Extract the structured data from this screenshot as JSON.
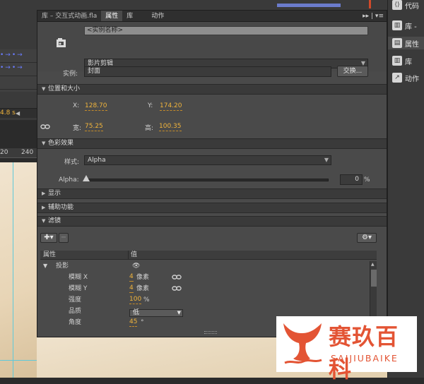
{
  "timeline": {
    "time": "4.8 s"
  },
  "ruler": {
    "ticks": [
      "20",
      "240"
    ]
  },
  "right_panel": {
    "items": [
      {
        "label": "代码"
      },
      {
        "label": "库 -"
      },
      {
        "label": "属性"
      },
      {
        "label": "库"
      },
      {
        "label": "动作"
      }
    ]
  },
  "props": {
    "tabs": {
      "doc": "库 – 交互式动画.fla",
      "properties": "属性",
      "library": "库",
      "actions": "动作",
      "buttons": "▸▸ | ▾≡"
    },
    "instance_name_placeholder": "<实例名称>",
    "symbol_type": "影片剪辑",
    "instance_label": "实例:",
    "instance_value": "封面",
    "swap_button": "交换...",
    "sections": {
      "position_size": "位置和大小",
      "color_effect": "色彩效果",
      "display": "显示",
      "accessibility": "辅助功能",
      "filters": "滤镜"
    },
    "position": {
      "x_label": "X:",
      "x_value": "128.70",
      "y_label": "Y:",
      "y_value": "174.20",
      "w_label": "宽:",
      "w_value": "75.25",
      "h_label": "高:",
      "h_value": "100.35"
    },
    "color": {
      "style_label": "样式:",
      "style_value": "Alpha",
      "alpha_label": "Alpha:",
      "alpha_value": "0",
      "alpha_unit": "%",
      "alpha_level": 0
    },
    "filters": {
      "col_property": "属性",
      "col_value": "值",
      "filter_name": "投影",
      "rows": [
        {
          "name": "模糊 X",
          "value": "4",
          "unit": "像素"
        },
        {
          "name": "模糊 Y",
          "value": "4",
          "unit": "像素"
        },
        {
          "name": "强度",
          "value": "100",
          "unit": "%"
        },
        {
          "name": "品质",
          "value": "低"
        },
        {
          "name": "角度",
          "value": "45",
          "unit": "°"
        }
      ]
    }
  },
  "watermark": {
    "title": "赛玖百科",
    "subtitle": "SAIJIUBAIKE"
  },
  "colors": {
    "accent_value": "#f0b43c",
    "panel_bg": "#4a4a4a",
    "watermark": "#e35434"
  }
}
